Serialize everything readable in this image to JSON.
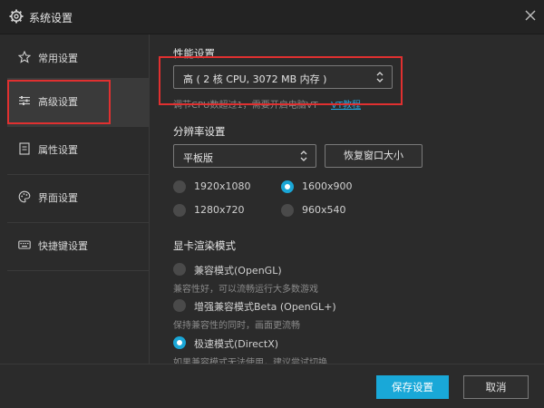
{
  "window": {
    "title": "系统设置"
  },
  "sidebar": {
    "items": [
      {
        "label": "常用设置",
        "icon": "star-icon"
      },
      {
        "label": "高级设置",
        "icon": "sliders-icon",
        "active": true
      },
      {
        "label": "属性设置",
        "icon": "document-icon"
      },
      {
        "label": "界面设置",
        "icon": "palette-icon"
      },
      {
        "label": "快捷键设置",
        "icon": "keyboard-icon"
      }
    ]
  },
  "performance": {
    "heading": "性能设置",
    "selected": "高 ( 2 核 CPU, 3072 MB 内存 )",
    "hint_prefix": "调节CPU数超过1，需要开启电脑VT",
    "hint_link": "VT教程"
  },
  "resolution": {
    "heading": "分辨率设置",
    "mode": "平板版",
    "reset_button": "恢复窗口大小",
    "options": [
      {
        "label": "1920x1080",
        "selected": false
      },
      {
        "label": "1600x900",
        "selected": true
      },
      {
        "label": "1280x720",
        "selected": false
      },
      {
        "label": "960x540",
        "selected": false
      }
    ]
  },
  "render": {
    "heading": "显卡渲染模式",
    "modes": [
      {
        "label": "兼容模式(OpenGL)",
        "desc": "兼容性好，可以流畅运行大多数游戏",
        "selected": false
      },
      {
        "label": "增强兼容模式Beta (OpenGL+)",
        "desc": "保持兼容性的同时，画面更流畅",
        "selected": false
      },
      {
        "label": "极速模式(DirectX)",
        "desc": "如果兼容模式无法使用，建议尝试切换",
        "selected": true
      }
    ]
  },
  "footer": {
    "save": "保存设置",
    "cancel": "取消"
  },
  "colors": {
    "accent": "#19a8d8",
    "highlight_box": "#e03030"
  }
}
